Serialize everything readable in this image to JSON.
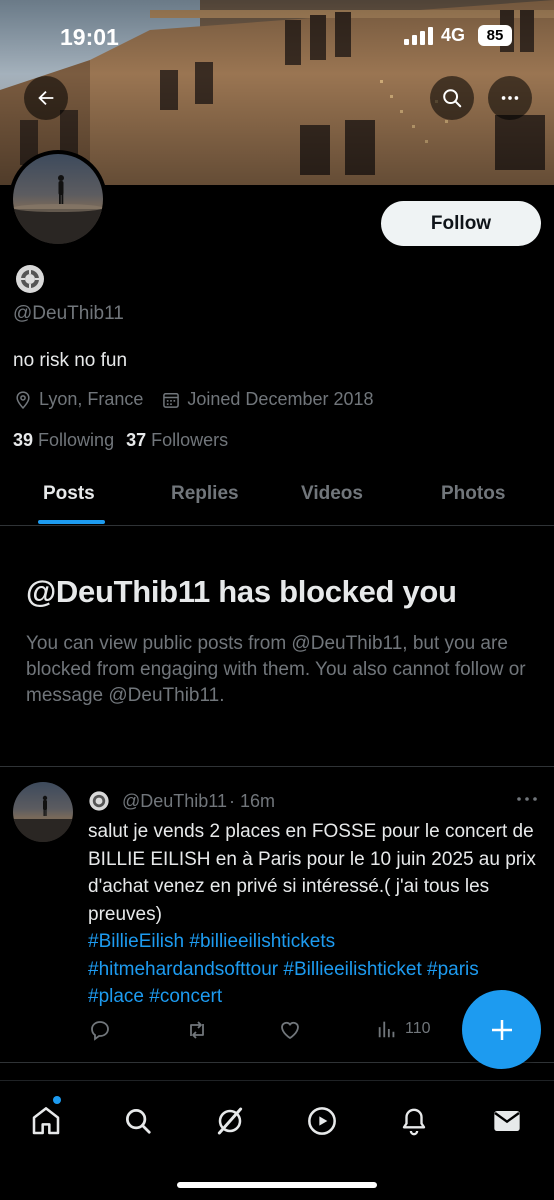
{
  "status_bar": {
    "time": "19:01",
    "network": "4G",
    "battery": "85"
  },
  "profile": {
    "handle": "@DeuThib11",
    "bio": "no risk no fun",
    "location": "Lyon, France",
    "joined": "Joined December 2018",
    "following_count": "39",
    "following_label": "Following",
    "followers_count": "37",
    "followers_label": "Followers",
    "follow_label": "Follow"
  },
  "tabs": [
    {
      "label": "Posts",
      "active": true
    },
    {
      "label": "Replies",
      "active": false
    },
    {
      "label": "Videos",
      "active": false
    },
    {
      "label": "Photos",
      "active": false
    }
  ],
  "blocked": {
    "title": "@DeuThib11 has blocked you",
    "body": "You can view public posts from @DeuThib11, but you are blocked from engaging with them. You also cannot follow or message @DeuThib11."
  },
  "post": {
    "handle": "@DeuThib11",
    "time": "· 16m",
    "text": "salut je vends 2 places en FOSSE pour le concert de BILLIE EILISH en à Paris pour le 10 juin 2025 au prix d'achat venez en privé si intéressé.( j'ai tous les preuves)",
    "hashtags": "#BillieEilish #billieeilishtickets #hitmehardandsofttour #Billieeilishticket #paris #place #concert",
    "views": "110"
  },
  "icons": {
    "back": "arrow-left-icon",
    "search": "search-icon",
    "more": "more-horizontal-icon",
    "location": "location-pin-icon",
    "calendar": "calendar-icon",
    "reply": "reply-icon",
    "repost": "repost-icon",
    "like": "heart-icon",
    "views": "views-bars-icon",
    "compose": "plus-icon"
  },
  "colors": {
    "accent": "#1d9bf0",
    "text": "#e7e9ea",
    "muted": "#71767b",
    "background": "#000000"
  }
}
